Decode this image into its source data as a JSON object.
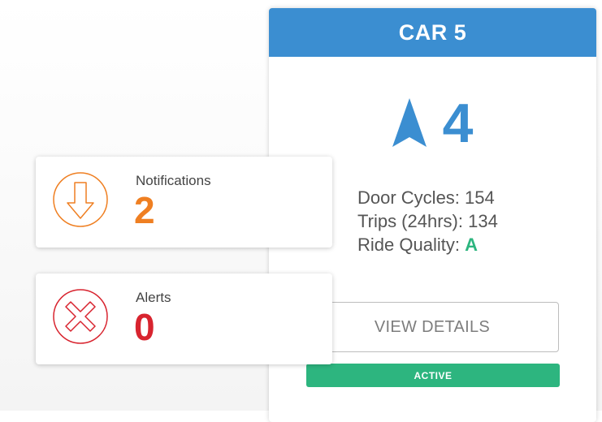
{
  "car": {
    "title": "CAR 5",
    "floor": "4",
    "direction_icon": "up-arrow-icon",
    "stats": {
      "door_cycles_label": "Door Cycles:",
      "door_cycles_value": "154",
      "trips_label": "Trips (24hrs):",
      "trips_value": "134",
      "ride_quality_label": "Ride Quality:",
      "ride_quality_value": "A"
    },
    "view_details_label": "VIEW DETAILS",
    "status_label": "ACTIVE"
  },
  "notifications": {
    "label": "Notifications",
    "count": "2",
    "icon": "down-arrow-circle-icon"
  },
  "alerts": {
    "label": "Alerts",
    "count": "0",
    "icon": "x-circle-icon"
  },
  "colors": {
    "header_blue": "#3b8ed1",
    "active_green": "#2db57f",
    "notification_orange": "#ef7f22",
    "alert_red": "#d8242f"
  }
}
